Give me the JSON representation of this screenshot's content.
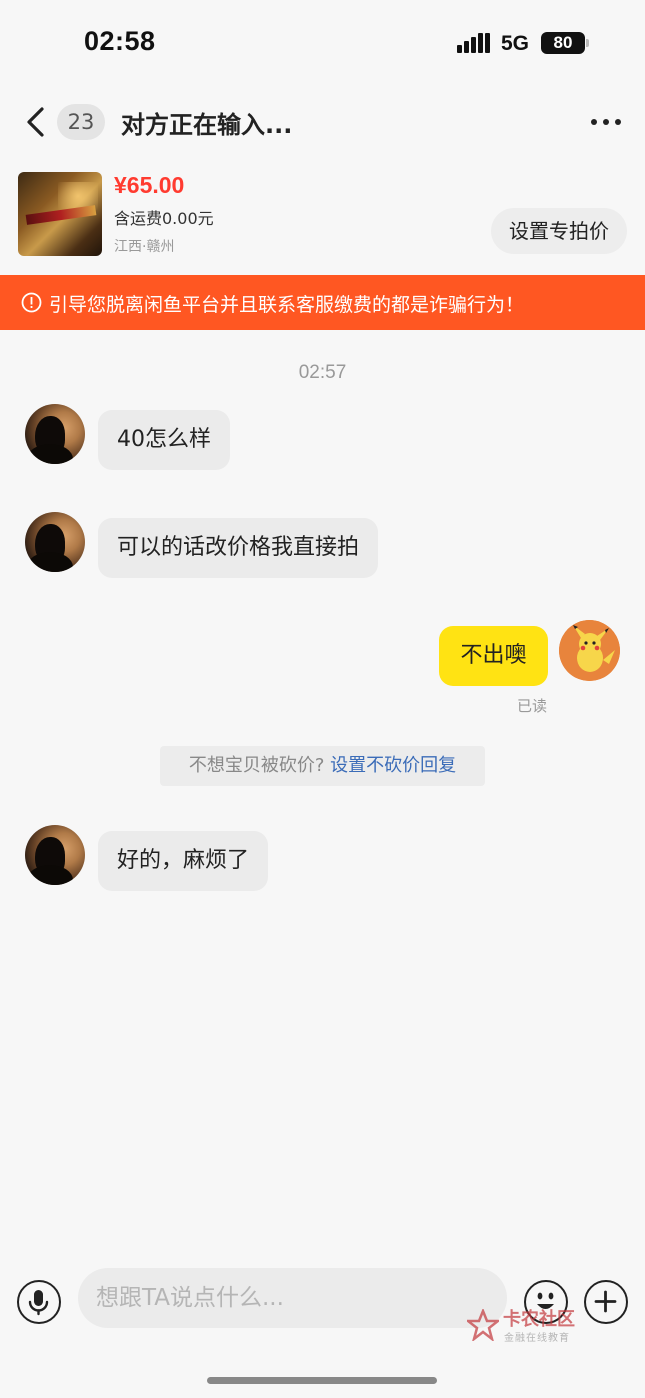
{
  "status_bar": {
    "time": "02:58",
    "network": "5G",
    "battery": "80"
  },
  "nav": {
    "unread_count": "23",
    "title": "对方正在输入..."
  },
  "product": {
    "price": "¥65.00",
    "shipping": "含运费0.00元",
    "location": "江西·赣州",
    "special_price_label": "设置专拍价"
  },
  "warning": {
    "text": "引导您脱离闲鱼平台并且联系客服缴费的都是诈骗行为！"
  },
  "chat": {
    "timestamp": "02:57",
    "messages": [
      {
        "from": "other",
        "text": "40怎么样"
      },
      {
        "from": "other",
        "text": "可以的话改价格我直接拍"
      },
      {
        "from": "self",
        "text": "不出噢",
        "status": "已读"
      },
      {
        "from": "other",
        "text": "好的，麻烦了"
      }
    ],
    "system_tip": {
      "text": "不想宝贝被砍价? ",
      "link": "设置不砍价回复"
    }
  },
  "input": {
    "placeholder": "想跟TA说点什么..."
  },
  "watermark": {
    "title": "卡农社区",
    "subtitle": "金融在线教育"
  },
  "colors": {
    "accent_yellow": "#ffe313",
    "warning_orange": "#ff5722",
    "price_red": "#ff3b30",
    "link_blue": "#3b6cb8"
  }
}
